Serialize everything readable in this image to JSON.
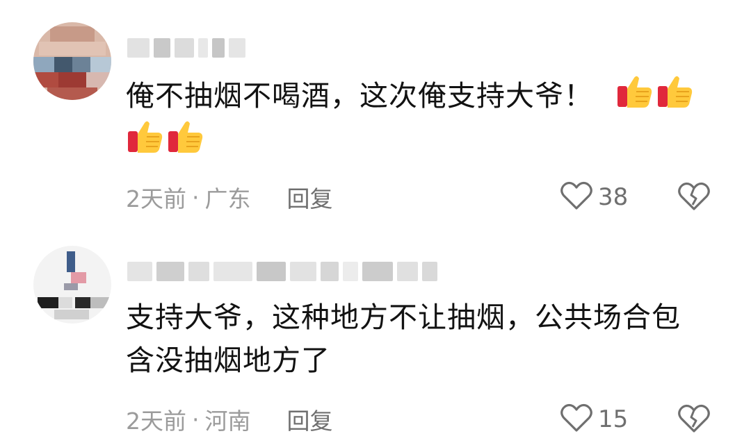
{
  "comments": [
    {
      "text": "俺不抽烟不喝酒，这次俺支持大爷！",
      "emoji_count": 4,
      "emoji_name": "thumbs-up-emoji",
      "time": "2天前",
      "separator": "·",
      "location": "广东",
      "reply_label": "回复",
      "like_count": "38",
      "like_icon": "heart-outline-icon",
      "dislike_icon": "broken-heart-icon"
    },
    {
      "text": "支持大爷，这种地方不让抽烟，公共场合包含没抽烟地方了",
      "time": "2天前",
      "separator": "·",
      "location": "河南",
      "reply_label": "回复",
      "like_count": "15",
      "like_icon": "heart-outline-icon",
      "dislike_icon": "broken-heart-icon"
    }
  ],
  "colors": {
    "text": "#121212",
    "meta": "#9b9b9b",
    "action": "#6f6f6f",
    "background": "#ffffff"
  }
}
